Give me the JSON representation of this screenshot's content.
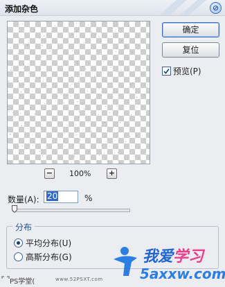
{
  "window": {
    "title": "添加杂色",
    "close_icon": "close-icon"
  },
  "preview": {
    "zoom_out": "−",
    "zoom_in": "+",
    "zoom_level": "100%"
  },
  "buttons": {
    "ok": "确定",
    "reset": "复位"
  },
  "preview_toggle": {
    "label": "预览(P)",
    "checked": true
  },
  "amount": {
    "label": "数量(A):",
    "value": "20",
    "unit": "%",
    "slider_fraction": 0.02
  },
  "distribution": {
    "title": "分布",
    "options": [
      {
        "label": "平均分布(U)",
        "selected": true
      },
      {
        "label": "高斯分布(G)",
        "selected": false
      }
    ]
  },
  "watermark": {
    "brand_left": "PS学堂(",
    "site_left": "www.52PSXT.com",
    "logo_line1_a": "我爱",
    "logo_line1_b": "学习",
    "logo_line2": "5axxw.com"
  },
  "colors": {
    "accent": "#3169c6",
    "logo_blue": "#1f66d1",
    "logo_pink": "#e83e8c"
  }
}
